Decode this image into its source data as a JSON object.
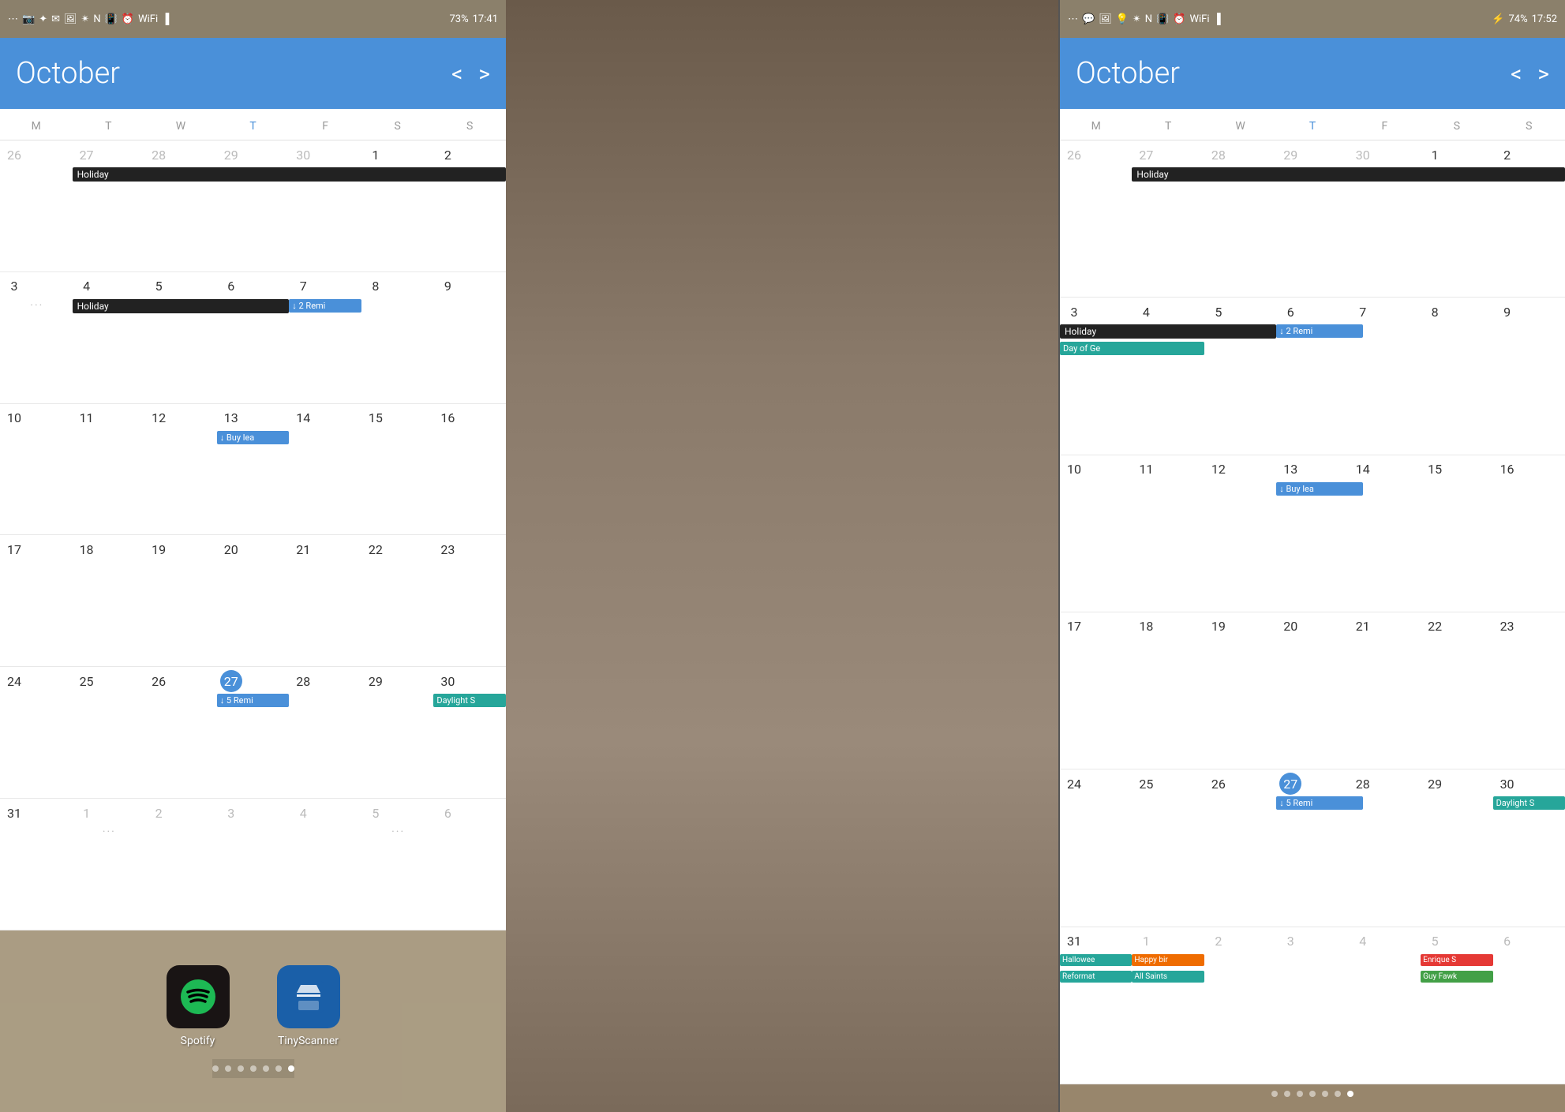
{
  "left_panel": {
    "status_bar": {
      "time": "17:41",
      "battery": "73%"
    },
    "header": {
      "month": "October",
      "prev_arrow": "<",
      "next_arrow": ">"
    },
    "day_headers": [
      "M",
      "T",
      "W",
      "T",
      "F",
      "S",
      "S"
    ],
    "weeks": [
      {
        "days": [
          {
            "num": "26",
            "other": true
          },
          {
            "num": "27",
            "other": true
          },
          {
            "num": "28",
            "other": true
          },
          {
            "num": "29",
            "other": true
          },
          {
            "num": "30",
            "other": true
          },
          {
            "num": "1"
          },
          {
            "num": "2"
          }
        ],
        "events": [
          {
            "col_start": 2,
            "col_span": 6,
            "label": "Holiday",
            "style": "black"
          }
        ]
      },
      {
        "days": [
          {
            "num": "3",
            "dots": true
          },
          {
            "num": "4"
          },
          {
            "num": "5"
          },
          {
            "num": "6"
          },
          {
            "num": "7"
          },
          {
            "num": "8"
          },
          {
            "num": "9"
          }
        ],
        "events": [
          {
            "col_start": 2,
            "col_span": 3,
            "label": "Holiday",
            "style": "black"
          },
          {
            "col_start": 5,
            "col_span": 1,
            "label": "↓ 2 Remi",
            "style": "blue"
          }
        ]
      },
      {
        "days": [
          {
            "num": "10"
          },
          {
            "num": "11"
          },
          {
            "num": "12"
          },
          {
            "num": "13"
          },
          {
            "num": "14"
          },
          {
            "num": "15"
          },
          {
            "num": "16"
          }
        ],
        "events": [
          {
            "col_start": 4,
            "col_span": 1,
            "label": "↓ Buy lea",
            "style": "blue"
          }
        ]
      },
      {
        "days": [
          {
            "num": "17"
          },
          {
            "num": "18"
          },
          {
            "num": "19"
          },
          {
            "num": "20"
          },
          {
            "num": "21"
          },
          {
            "num": "22"
          },
          {
            "num": "23"
          }
        ],
        "events": []
      },
      {
        "days": [
          {
            "num": "24"
          },
          {
            "num": "25"
          },
          {
            "num": "26"
          },
          {
            "num": "27",
            "today": true
          },
          {
            "num": "28"
          },
          {
            "num": "29"
          },
          {
            "num": "30"
          }
        ],
        "events": [
          {
            "col_start": 4,
            "col_span": 1,
            "label": "↓ 5 Remi",
            "style": "blue"
          },
          {
            "col_start": 7,
            "col_span": 1,
            "label": "Daylight S",
            "style": "teal"
          }
        ]
      },
      {
        "days": [
          {
            "num": "31"
          },
          {
            "num": "1",
            "other": true,
            "dots": true
          },
          {
            "num": "2",
            "other": true
          },
          {
            "num": "3",
            "other": true
          },
          {
            "num": "4",
            "other": true
          },
          {
            "num": "5",
            "other": true,
            "dots": true
          },
          {
            "num": "6",
            "other": true
          }
        ],
        "events": []
      }
    ],
    "apps": [
      {
        "name": "Spotify",
        "icon": "spotify"
      },
      {
        "name": "TinyScanner",
        "icon": "scanner"
      }
    ],
    "dots": [
      false,
      false,
      false,
      false,
      false,
      false,
      true
    ]
  },
  "right_panel": {
    "status_bar": {
      "time": "17:52",
      "battery": "74%"
    },
    "header": {
      "month": "October",
      "prev_arrow": "<",
      "next_arrow": ">"
    },
    "day_headers": [
      "M",
      "T",
      "W",
      "T",
      "F",
      "S",
      "S"
    ],
    "weeks": [
      {
        "days": [
          {
            "num": "26",
            "other": true
          },
          {
            "num": "27",
            "other": true
          },
          {
            "num": "28",
            "other": true
          },
          {
            "num": "29",
            "other": true
          },
          {
            "num": "30",
            "other": true
          },
          {
            "num": "1"
          },
          {
            "num": "2"
          }
        ],
        "events": [
          {
            "col_start": 2,
            "col_span": 6,
            "label": "Holiday",
            "style": "black"
          }
        ]
      },
      {
        "days": [
          {
            "num": "3"
          },
          {
            "num": "4"
          },
          {
            "num": "5"
          },
          {
            "num": "6"
          },
          {
            "num": "7"
          },
          {
            "num": "8"
          },
          {
            "num": "9"
          }
        ],
        "events": [
          {
            "col_start": 1,
            "col_span": 3,
            "label": "Holiday",
            "style": "black"
          },
          {
            "col_start": 4,
            "col_span": 1,
            "label": "↓ 2 Remi",
            "style": "blue"
          },
          {
            "col_start": 1,
            "col_span": 2,
            "label": "Day of Ge",
            "style": "teal",
            "row": 2
          }
        ]
      },
      {
        "days": [
          {
            "num": "10"
          },
          {
            "num": "11"
          },
          {
            "num": "12"
          },
          {
            "num": "13"
          },
          {
            "num": "14"
          },
          {
            "num": "15"
          },
          {
            "num": "16"
          }
        ],
        "events": [
          {
            "col_start": 4,
            "col_span": 1,
            "label": "↓ Buy lea",
            "style": "blue"
          }
        ]
      },
      {
        "days": [
          {
            "num": "17"
          },
          {
            "num": "18"
          },
          {
            "num": "19"
          },
          {
            "num": "20"
          },
          {
            "num": "21"
          },
          {
            "num": "22"
          },
          {
            "num": "23"
          }
        ],
        "events": []
      },
      {
        "days": [
          {
            "num": "24"
          },
          {
            "num": "25"
          },
          {
            "num": "26"
          },
          {
            "num": "27",
            "today": true
          },
          {
            "num": "28"
          },
          {
            "num": "29"
          },
          {
            "num": "30"
          }
        ],
        "events": [
          {
            "col_start": 4,
            "col_span": 1,
            "label": "↓ 5 Remi",
            "style": "blue"
          },
          {
            "col_start": 7,
            "col_span": 1,
            "label": "Daylight S",
            "style": "teal"
          }
        ]
      },
      {
        "days": [
          {
            "num": "31"
          },
          {
            "num": "1",
            "other": true
          },
          {
            "num": "2",
            "other": true
          },
          {
            "num": "3",
            "other": true
          },
          {
            "num": "4",
            "other": true
          },
          {
            "num": "5",
            "other": true
          },
          {
            "num": "6",
            "other": true
          }
        ],
        "events": [
          {
            "col_start": 1,
            "col_span": 1,
            "label": "Hallowee",
            "style": "teal"
          },
          {
            "col_start": 2,
            "col_span": 1,
            "label": "Happy bir",
            "style": "orange"
          },
          {
            "col_start": 1,
            "col_span": 1,
            "label": "Reformat",
            "style": "teal",
            "row": 2
          },
          {
            "col_start": 2,
            "col_span": 1,
            "label": "All Saints",
            "style": "teal",
            "row": 2
          },
          {
            "col_start": 6,
            "col_span": 1,
            "label": "Enrique S",
            "style": "red"
          },
          {
            "col_start": 6,
            "col_span": 1,
            "label": "Guy Fawk",
            "style": "green",
            "row": 2
          }
        ]
      }
    ],
    "dots": [
      false,
      false,
      false,
      false,
      false,
      false,
      true
    ]
  }
}
